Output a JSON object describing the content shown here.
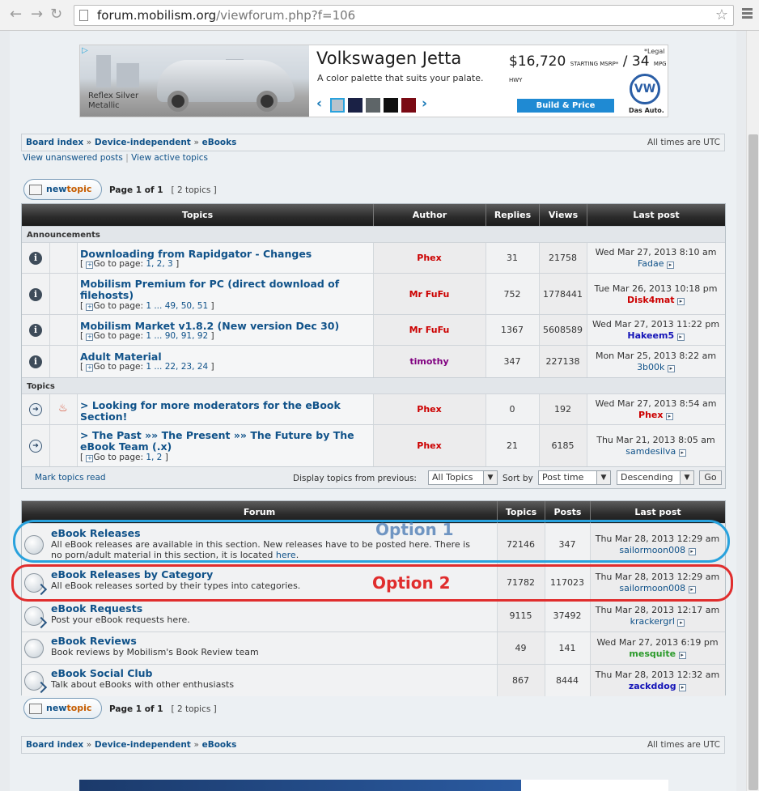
{
  "browser": {
    "url_host": "forum.mobilism.org",
    "url_path": "/viewforum.php?f=106"
  },
  "ad": {
    "car_label": "Reflex Silver Metallic",
    "brand": "Volkswagen Jetta",
    "tagline": "A color palette that suits your palate.",
    "price": "$16,720",
    "mpg": "/ 34",
    "legal": "*Legal",
    "cta": "Build & Price",
    "logo_text": "VW",
    "sublogo": "Das Auto.",
    "swatches": [
      "#b9c3cc",
      "#1a2145",
      "#5e6568",
      "#0f0f0f",
      "#7a0a14"
    ]
  },
  "breadcrumb": {
    "board_index": "Board index",
    "sep": "»",
    "device_independent": "Device-independent",
    "ebooks": "eBooks",
    "timezone": "All times are UTC"
  },
  "sublinks": {
    "unanswered": "View unanswered posts",
    "sep": "|",
    "active": "View active topics"
  },
  "newtopic": {
    "pre": "new",
    "post": "topic"
  },
  "pagination": {
    "label": "Page 1 of 1",
    "count": "[ 2 topics ]"
  },
  "topics_table": {
    "headers": [
      "Topics",
      "Author",
      "Replies",
      "Views",
      "Last post"
    ],
    "announcements_label": "Announcements",
    "topics_label": "Topics",
    "announcements": [
      {
        "title": "Downloading from Rapidgator - Changes",
        "title2": "",
        "goto": "Go to page:",
        "pages": "1, 2, 3",
        "author": "Phex",
        "author_color": "#cc0000",
        "replies": "31",
        "views": "21758",
        "lp_date": "Wed Mar 27, 2013 8:10 am",
        "lp_user": "Fadae",
        "lp_user_color": "#105289",
        "lp_user_bold": false
      },
      {
        "title": "Mobilism Premium for PC (direct download of",
        "title2": "filehosts)",
        "goto": "Go to page:",
        "pages": "1 ... 49, 50, 51",
        "author": "Mr FuFu",
        "author_color": "#cc0000",
        "replies": "752",
        "views": "1778441",
        "lp_date": "Tue Mar 26, 2013 10:18 pm",
        "lp_user": "Disk4mat",
        "lp_user_color": "#cc0000",
        "lp_user_bold": true
      },
      {
        "title": "Mobilism Market v1.8.2 (New version Dec 30)",
        "title2": "",
        "goto": "Go to page:",
        "pages": "1 ... 90, 91, 92",
        "author": "Mr FuFu",
        "author_color": "#cc0000",
        "replies": "1367",
        "views": "5608589",
        "lp_date": "Wed Mar 27, 2013 11:22 pm",
        "lp_user": "Hakeem5",
        "lp_user_color": "#1414b8",
        "lp_user_bold": true
      },
      {
        "title": "Adult Material",
        "title2": "",
        "goto": "Go to page:",
        "pages": "1 ... 22, 23, 24",
        "author": "timothy",
        "author_color": "#800080",
        "replies": "347",
        "views": "227138",
        "lp_date": "Mon Mar 25, 2013 8:22 am",
        "lp_user": "3b00k",
        "lp_user_color": "#105289",
        "lp_user_bold": false
      }
    ],
    "topics": [
      {
        "title": "> Looking for more moderators for the eBook Section!",
        "title2": "",
        "goto": "",
        "pages": "",
        "author": "Phex",
        "author_color": "#cc0000",
        "replies": "0",
        "views": "192",
        "lp_date": "Wed Mar 27, 2013 8:54 am",
        "lp_user": "Phex",
        "lp_user_color": "#cc0000",
        "lp_user_bold": true
      },
      {
        "title": "> The Past »» The Present »» The Future by The",
        "title2": "eBook Team (.x)",
        "goto": "Go to page:",
        "pages": "1, 2",
        "author": "Phex",
        "author_color": "#cc0000",
        "replies": "21",
        "views": "6185",
        "lp_date": "Thu Mar 21, 2013 8:05 am",
        "lp_user": "samdesilva",
        "lp_user_color": "#105289",
        "lp_user_bold": false
      }
    ]
  },
  "footer_controls": {
    "mark_read": "Mark topics read",
    "display_label": "Display topics from previous:",
    "display_value": "All Topics",
    "sort_label": "Sort by",
    "sort_value": "Post time",
    "order_value": "Descending",
    "go": "Go"
  },
  "forum_table": {
    "headers": [
      "Forum",
      "Topics",
      "Posts",
      "Last post"
    ],
    "rows": [
      {
        "name": "eBook Releases",
        "desc1": "All eBook releases are available in this section. New releases have to be posted here. There is",
        "desc2": "no porn/adult material in this section, it is located",
        "desc_link": "here",
        "desc_end": ".",
        "topics": "72146",
        "posts": "347",
        "lp_date": "Thu Mar 28, 2013 12:29 am",
        "lp_user": "sailormoon008",
        "lp_user_color": "#105289",
        "lp_user_bold": false
      },
      {
        "name": "eBook Releases by Category",
        "desc1": "All eBook releases sorted by their types into categories.",
        "desc2": "",
        "desc_link": "",
        "desc_end": "",
        "topics": "71782",
        "posts": "117023",
        "lp_date": "Thu Mar 28, 2013 12:29 am",
        "lp_user": "sailormoon008",
        "lp_user_color": "#105289",
        "lp_user_bold": false
      },
      {
        "name": "eBook Requests",
        "desc1": "Post your eBook requests here.",
        "desc2": "",
        "desc_link": "",
        "desc_end": "",
        "topics": "9115",
        "posts": "37492",
        "lp_date": "Thu Mar 28, 2013 12:17 am",
        "lp_user": "krackergrl",
        "lp_user_color": "#105289",
        "lp_user_bold": false
      },
      {
        "name": "eBook Reviews",
        "desc1": "Book reviews by Mobilism's Book Review team",
        "desc2": "",
        "desc_link": "",
        "desc_end": "",
        "topics": "49",
        "posts": "141",
        "lp_date": "Wed Mar 27, 2013 6:19 pm",
        "lp_user": "mesquite",
        "lp_user_color": "#2a9a2a",
        "lp_user_bold": true
      },
      {
        "name": "eBook Social Club",
        "desc1": "Talk about eBooks with other enthusiasts",
        "desc2": "",
        "desc_link": "",
        "desc_end": "",
        "topics": "867",
        "posts": "8444",
        "lp_date": "Thu Mar 28, 2013 12:32 am",
        "lp_user": "zackddog",
        "lp_user_color": "#1414b8",
        "lp_user_bold": true
      }
    ]
  },
  "annotations": {
    "option1": "Option 1",
    "option2": "Option 2",
    "option1_color": "#29a2dd",
    "option2_color": "#e02d2d"
  },
  "icons": {
    "back": "back-arrow-icon",
    "forward": "forward-arrow-icon",
    "reload": "reload-icon",
    "home": "home-icon",
    "star": "bookmark-star-icon",
    "menu": "menu-icon",
    "info": "info-icon",
    "hot": "fire-icon",
    "jump": "jump-to-post-icon"
  }
}
